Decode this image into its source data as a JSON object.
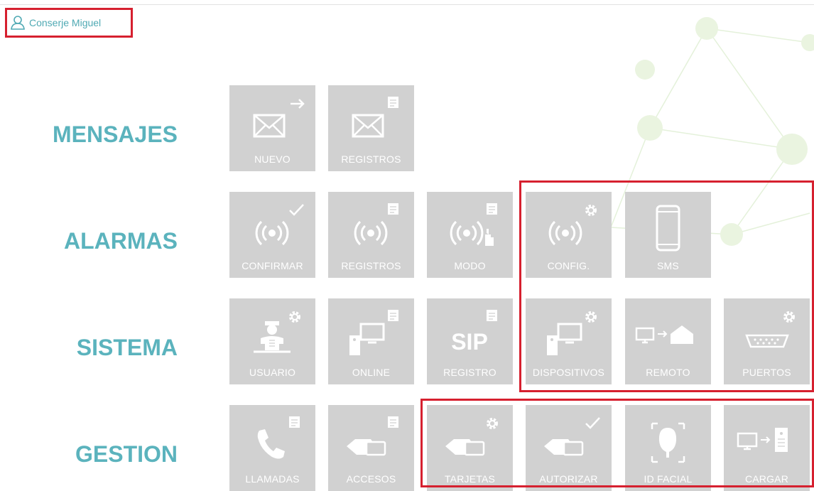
{
  "user": {
    "name": "Conserje  Miguel",
    "icon": "user-icon"
  },
  "colors": {
    "accent": "#5bb3bd",
    "tile": "#d1d1d1",
    "highlight": "#d6202f",
    "icon": "#ffffff"
  },
  "sections": [
    {
      "id": "mensajes",
      "title": "MENSAJES",
      "tiles": [
        {
          "id": "nuevo",
          "label": "NUEVO",
          "icon": "envelope-icon",
          "badge": "arrow"
        },
        {
          "id": "registros",
          "label": "REGISTROS",
          "icon": "envelope-icon",
          "badge": "doc"
        }
      ]
    },
    {
      "id": "alarmas",
      "title": "ALARMAS",
      "tiles": [
        {
          "id": "confirmar",
          "label": "CONFIRMAR",
          "icon": "alarm-icon",
          "badge": "check"
        },
        {
          "id": "registros",
          "label": "REGISTROS",
          "icon": "alarm-icon",
          "badge": "doc"
        },
        {
          "id": "modo",
          "label": "MODO",
          "icon": "alarm-hand-icon",
          "badge": "doc"
        },
        {
          "id": "config",
          "label": "CONFIG.",
          "icon": "alarm-icon",
          "badge": "gear"
        },
        {
          "id": "sms",
          "label": "SMS",
          "icon": "phone-icon",
          "badge": ""
        }
      ]
    },
    {
      "id": "sistema",
      "title": "SISTEMA",
      "tiles": [
        {
          "id": "usuario",
          "label": "USUARIO",
          "icon": "concierge-icon",
          "badge": "gear"
        },
        {
          "id": "online",
          "label": "ONLINE",
          "icon": "monitor-device-icon",
          "badge": "doc"
        },
        {
          "id": "registro",
          "label": "REGISTRO",
          "icon": "sip-icon",
          "badge": "doc",
          "text": "SIP"
        },
        {
          "id": "dispositivos",
          "label": "DISPOSITIVOS",
          "icon": "monitor-device-icon",
          "badge": "gear"
        },
        {
          "id": "remoto",
          "label": "REMOTO",
          "icon": "monitor-home-icon",
          "badge": ""
        },
        {
          "id": "puertos",
          "label": "PUERTOS",
          "icon": "serial-port-icon",
          "badge": "gear"
        }
      ]
    },
    {
      "id": "gestion",
      "title": "GESTION",
      "tiles": [
        {
          "id": "llamadas",
          "label": "LLAMADAS",
          "icon": "phone-handset-icon",
          "badge": "doc"
        },
        {
          "id": "accesos",
          "label": "ACCESOS",
          "icon": "card-hand-icon",
          "badge": "doc"
        },
        {
          "id": "tarjetas",
          "label": "TARJETAS",
          "icon": "card-hand-icon",
          "badge": "gear"
        },
        {
          "id": "autorizar",
          "label": "AUTORIZAR",
          "icon": "card-hand-icon",
          "badge": "check"
        },
        {
          "id": "id-facial",
          "label": "ID FACIAL",
          "icon": "face-id-icon",
          "badge": ""
        },
        {
          "id": "cargar",
          "label": "CARGAR",
          "icon": "monitor-upload-icon",
          "badge": ""
        }
      ]
    }
  ]
}
